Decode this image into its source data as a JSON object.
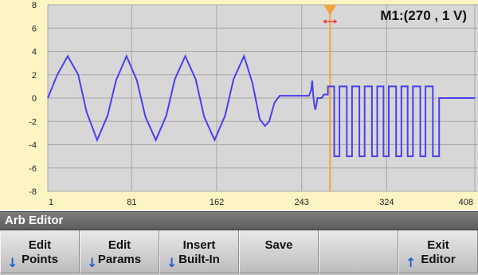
{
  "marker": {
    "readout": "M1:(270 , 1 V)",
    "marker_x": 270
  },
  "title_bar": {
    "title": "Arb Editor"
  },
  "softkeys": [
    {
      "line1": "Edit",
      "line2": "Points",
      "arrow": "down"
    },
    {
      "line1": "Edit",
      "line2": "Params",
      "arrow": "down"
    },
    {
      "line1": "Insert",
      "line2": "Built-In",
      "arrow": "down"
    },
    {
      "line1": "Save",
      "line2": "",
      "arrow": ""
    },
    {
      "line1": "",
      "line2": "",
      "arrow": ""
    },
    {
      "line1": "Exit",
      "line2": "Editor",
      "arrow": "up"
    }
  ],
  "icons": {
    "marker": "triangle-marker-icon",
    "drag": "drag-handle-icon",
    "down_arrow": "down-arrow-icon",
    "up_arrow": "up-arrow-icon"
  },
  "colors": {
    "plot_bg": "#fdf4c4",
    "grid": "#a7a7a7",
    "trace": "#4a3ff0",
    "marker": "#f1a43a",
    "drag_handle": "#e84040",
    "title_bar": "#6b6b6b",
    "arrow": "#1f5fd0"
  },
  "chart_data": {
    "type": "line",
    "x_ticks": [
      "1",
      "81",
      "162",
      "243",
      "324",
      "408"
    ],
    "y_ticks": [
      "8",
      "6",
      "4",
      "2",
      "0",
      "-2",
      "-4",
      "-6",
      "-8"
    ],
    "xlim": [
      1,
      408
    ],
    "ylim": [
      -8,
      8
    ],
    "grid": true,
    "series": [
      {
        "points": [
          [
            1,
            0
          ],
          [
            10,
            2.0
          ],
          [
            20,
            3.6
          ],
          [
            30,
            2.0
          ],
          [
            38,
            -1.2
          ],
          [
            48,
            -3.6
          ],
          [
            58,
            -1.5
          ],
          [
            66,
            1.5
          ],
          [
            76,
            3.6
          ],
          [
            86,
            1.5
          ],
          [
            94,
            -1.6
          ],
          [
            104,
            -3.6
          ],
          [
            114,
            -1.5
          ],
          [
            122,
            1.6
          ],
          [
            132,
            3.6
          ],
          [
            142,
            1.6
          ],
          [
            150,
            -1.6
          ],
          [
            160,
            -3.6
          ],
          [
            170,
            -1.5
          ],
          [
            178,
            1.6
          ],
          [
            188,
            3.6
          ],
          [
            196,
            1.3
          ],
          [
            203,
            -1.8
          ],
          [
            208,
            -2.4
          ],
          [
            212,
            -2.0
          ],
          [
            217,
            -0.4
          ],
          [
            222,
            0.2
          ],
          [
            226,
            0.2
          ],
          [
            250,
            0.2
          ],
          [
            252,
            0.7
          ],
          [
            253,
            1.5
          ],
          [
            254,
            0.2
          ],
          [
            255,
            -0.6
          ],
          [
            256,
            -1.0
          ],
          [
            257,
            -0.6
          ],
          [
            258,
            0
          ],
          [
            262,
            0
          ],
          [
            264,
            0.3
          ],
          [
            266,
            0.3
          ],
          [
            268,
            0.3
          ],
          [
            268,
            1.0
          ],
          [
            274,
            1.0
          ],
          [
            274,
            -5.0
          ],
          [
            279,
            -5.0
          ],
          [
            279,
            1.0
          ],
          [
            286,
            1.0
          ],
          [
            286,
            -5.0
          ],
          [
            291,
            -5.0
          ],
          [
            291,
            1.0
          ],
          [
            298,
            1.0
          ],
          [
            298,
            -5.0
          ],
          [
            303,
            -5.0
          ],
          [
            303,
            1.0
          ],
          [
            310,
            1.0
          ],
          [
            310,
            -5.0
          ],
          [
            315,
            -5.0
          ],
          [
            315,
            1.0
          ],
          [
            321,
            1.0
          ],
          [
            321,
            -5.0
          ],
          [
            326,
            -5.0
          ],
          [
            326,
            1.0
          ],
          [
            333,
            1.0
          ],
          [
            333,
            -5.0
          ],
          [
            338,
            -5.0
          ],
          [
            338,
            1.0
          ],
          [
            344,
            1.0
          ],
          [
            344,
            -5.0
          ],
          [
            349,
            -5.0
          ],
          [
            349,
            1.0
          ],
          [
            356,
            1.0
          ],
          [
            356,
            -5.0
          ],
          [
            361,
            -5.0
          ],
          [
            361,
            1.0
          ],
          [
            368,
            1.0
          ],
          [
            368,
            -5.0
          ],
          [
            374,
            -5.0
          ],
          [
            374,
            0
          ],
          [
            408,
            0
          ]
        ]
      }
    ]
  }
}
